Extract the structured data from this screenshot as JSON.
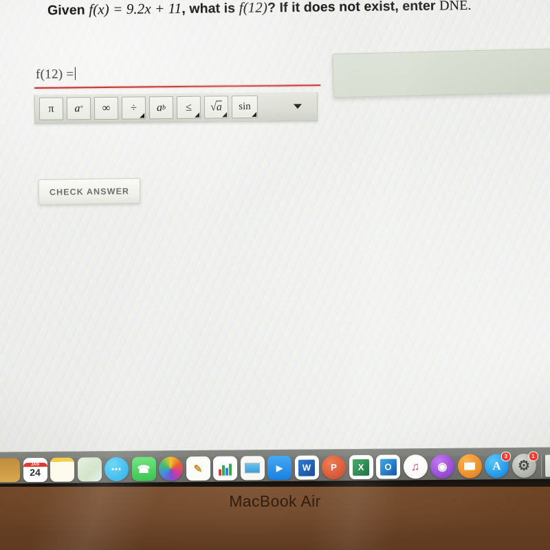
{
  "problem": {
    "prefix": "Given ",
    "function_def": "f(x) = 9.2x + 11",
    "middle": ", what is ",
    "evaluate": "f(12)",
    "suffix": "? If it does not exist, enter ",
    "dne": "DNE."
  },
  "answer_field": {
    "label": "f(12) =",
    "value": "",
    "has_caret": true,
    "underline_color": "#cf3a33"
  },
  "math_toolbar": {
    "buttons": [
      {
        "name": "pi",
        "label": "π",
        "has_submenu": false
      },
      {
        "name": "degree",
        "label": "a°",
        "has_submenu": false
      },
      {
        "name": "infinity",
        "label": "∞",
        "has_submenu": false
      },
      {
        "name": "divide",
        "label": "÷",
        "has_submenu": true
      },
      {
        "name": "exponent",
        "label": "aᵇ",
        "has_submenu": false
      },
      {
        "name": "less-than-or-equal",
        "label": "≤",
        "has_submenu": true
      },
      {
        "name": "square-root",
        "label": "√a",
        "has_submenu": true
      },
      {
        "name": "sine",
        "label": "sin",
        "has_submenu": true
      }
    ],
    "more_caret": "▼"
  },
  "check_button": {
    "label": "CHECK ANSWER"
  },
  "side_panel": {
    "text": "",
    "color": "#d8dfd2"
  },
  "dock": {
    "items": [
      {
        "name": "finder",
        "glyph": "",
        "color": "#3c8fd4",
        "shape": "rounded",
        "running": false
      },
      {
        "name": "calendar",
        "glyph": "24",
        "color": "#ffffff",
        "shape": "rounded",
        "running": false,
        "top_label": "JAN"
      },
      {
        "name": "notes",
        "glyph": "",
        "color": "#fdf6d8",
        "shape": "rounded",
        "running": false
      },
      {
        "name": "maps",
        "glyph": "",
        "color": "#eaf3e2",
        "shape": "rounded",
        "running": false
      },
      {
        "name": "messages",
        "glyph": "•••",
        "color": "#2eb9f0",
        "shape": "round",
        "running": true
      },
      {
        "name": "facetime",
        "glyph": "✆",
        "color": "#4cd964",
        "shape": "rounded",
        "running": false
      },
      {
        "name": "photos",
        "glyph": "❀",
        "color": "#ffffff",
        "shape": "round",
        "running": false
      },
      {
        "name": "pages",
        "glyph": "✎",
        "color": "#fafafa",
        "shape": "rounded",
        "running": false
      },
      {
        "name": "numbers",
        "glyph": "",
        "color": "#ffffff",
        "shape": "rounded",
        "running": false
      },
      {
        "name": "keynote",
        "glyph": "",
        "color": "#f5f5f5",
        "shape": "rounded",
        "running": false
      },
      {
        "name": "zoom",
        "glyph": "▶",
        "color": "#2196f3",
        "shape": "rounded",
        "running": false
      },
      {
        "name": "microsoft-word",
        "glyph": "W",
        "color": "#1b5fb0",
        "shape": "rounded",
        "running": true
      },
      {
        "name": "microsoft-powerpoint",
        "glyph": "P",
        "color": "#d2472a",
        "shape": "rounded",
        "running": false
      },
      {
        "name": "microsoft-excel",
        "glyph": "X",
        "color": "#1d7044",
        "shape": "rounded",
        "running": false
      },
      {
        "name": "microsoft-outlook",
        "glyph": "O",
        "color": "#1a74c4",
        "shape": "rounded",
        "running": true
      },
      {
        "name": "music",
        "glyph": "♫",
        "color": "#fdfdfd",
        "shape": "round",
        "running": false
      },
      {
        "name": "podcasts",
        "glyph": "◉",
        "color": "#9b4ddb",
        "shape": "round",
        "running": false
      },
      {
        "name": "books",
        "glyph": "□",
        "color": "#f08c28",
        "shape": "round",
        "running": false
      },
      {
        "name": "app-store",
        "glyph": "A",
        "color": "#1e9ff2",
        "shape": "round",
        "running": false,
        "badge": "3"
      },
      {
        "name": "system-preferences",
        "glyph": "⚙",
        "color": "#b9bcb6",
        "shape": "round",
        "running": false,
        "badge": "1"
      }
    ],
    "minimized_windows": [
      {
        "name": "minimized-document-window",
        "running": true
      },
      {
        "name": "minimized-browser-window",
        "running": true
      }
    ]
  },
  "laptop": {
    "model_label": "MacBook Air"
  }
}
